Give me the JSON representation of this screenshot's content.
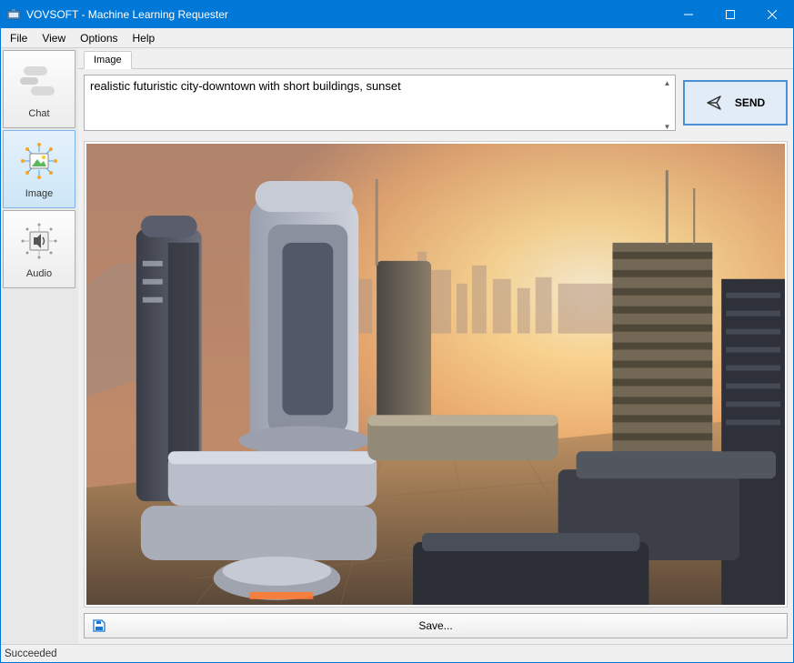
{
  "window": {
    "title": "VOVSOFT - Machine Learning Requester"
  },
  "menu": {
    "file": "File",
    "view": "View",
    "options": "Options",
    "help": "Help"
  },
  "sidebar": {
    "chat": "Chat",
    "image": "Image",
    "audio": "Audio",
    "selected": "image"
  },
  "tabs": {
    "image": "Image"
  },
  "prompt": {
    "value": "realistic futuristic city-downtown with short buildings, sunset"
  },
  "send": {
    "label": "SEND"
  },
  "save": {
    "label": "Save..."
  },
  "status": {
    "text": "Succeeded"
  },
  "colors": {
    "accent": "#0078d7"
  }
}
